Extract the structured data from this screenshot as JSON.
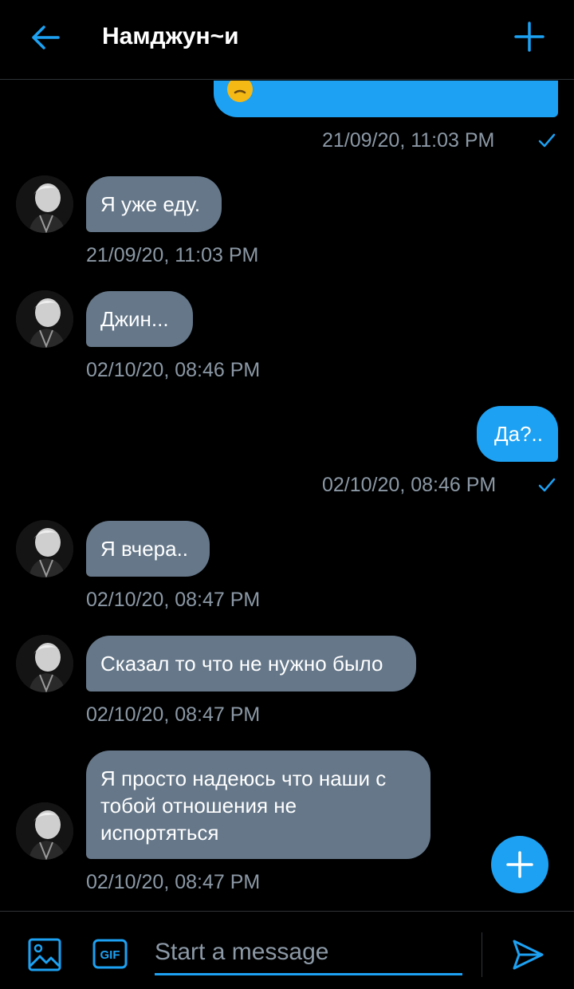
{
  "header": {
    "title": "Намджун~и"
  },
  "messages": [
    {
      "direction": "out",
      "text": "",
      "timestamp": "21/09/20, 11:03 PM",
      "read": true
    },
    {
      "direction": "in",
      "text": "Я уже еду.",
      "timestamp": "21/09/20, 11:03 PM"
    },
    {
      "direction": "in",
      "text": "Джин...",
      "timestamp": "02/10/20, 08:46 PM"
    },
    {
      "direction": "out",
      "text": "Да?..",
      "timestamp": "02/10/20, 08:46 PM",
      "read": true
    },
    {
      "direction": "in",
      "text": "Я вчера..",
      "timestamp": "02/10/20, 08:47 PM"
    },
    {
      "direction": "in",
      "text": "Сказал то что не нужно было",
      "timestamp": "02/10/20, 08:47 PM"
    },
    {
      "direction": "in",
      "text": "Я просто надеюсь что наши с тобой отношения не испортяться",
      "timestamp": "02/10/20, 08:47 PM"
    }
  ],
  "composer": {
    "placeholder": "Start a message",
    "gif_label": "GIF"
  },
  "colors": {
    "accent": "#1da1f2",
    "incoming_bubble": "#657789",
    "background": "#000000",
    "timestamp": "#8b98a5"
  },
  "icons": {
    "back": "arrow-left-icon",
    "new": "plus-icon",
    "read": "check-icon",
    "media": "image-icon",
    "gif": "gif-icon",
    "send": "send-icon",
    "fab": "plus-icon"
  }
}
